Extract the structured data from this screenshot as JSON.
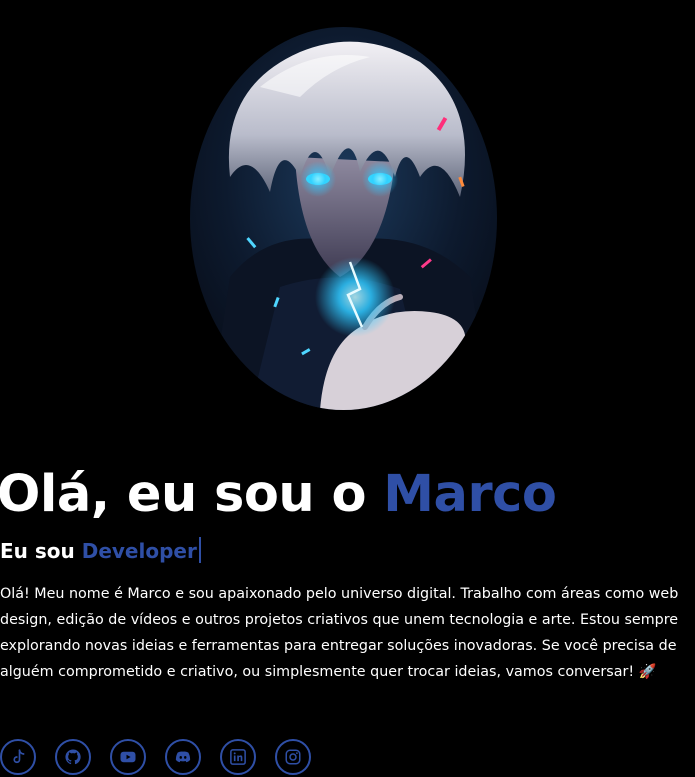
{
  "hero": {
    "greeting": "Olá, eu sou o ",
    "name": "Marco",
    "role_prefix": "Eu sou ",
    "role": "Developer"
  },
  "bio": {
    "text": "Olá! Meu nome é Marco e sou apaixonado pelo universo digital. Trabalho com áreas como web design, edição de vídeos e outros projetos criativos que unem tecnologia e arte. Estou sempre explorando novas ideias e ferramentas para entregar soluções inovadoras. Se você precisa de alguém comprometido e criativo, ou simplesmente quer trocar ideias, vamos conversar! ",
    "emoji": "🚀"
  },
  "socials": [
    {
      "icon": "tiktok-icon"
    },
    {
      "icon": "github-icon"
    },
    {
      "icon": "youtube-icon"
    },
    {
      "icon": "discord-icon"
    },
    {
      "icon": "linkedin-icon"
    },
    {
      "icon": "instagram-icon"
    }
  ],
  "colors": {
    "background": "#000000",
    "accent": "#2f4fa6",
    "text": "#ffffff"
  }
}
